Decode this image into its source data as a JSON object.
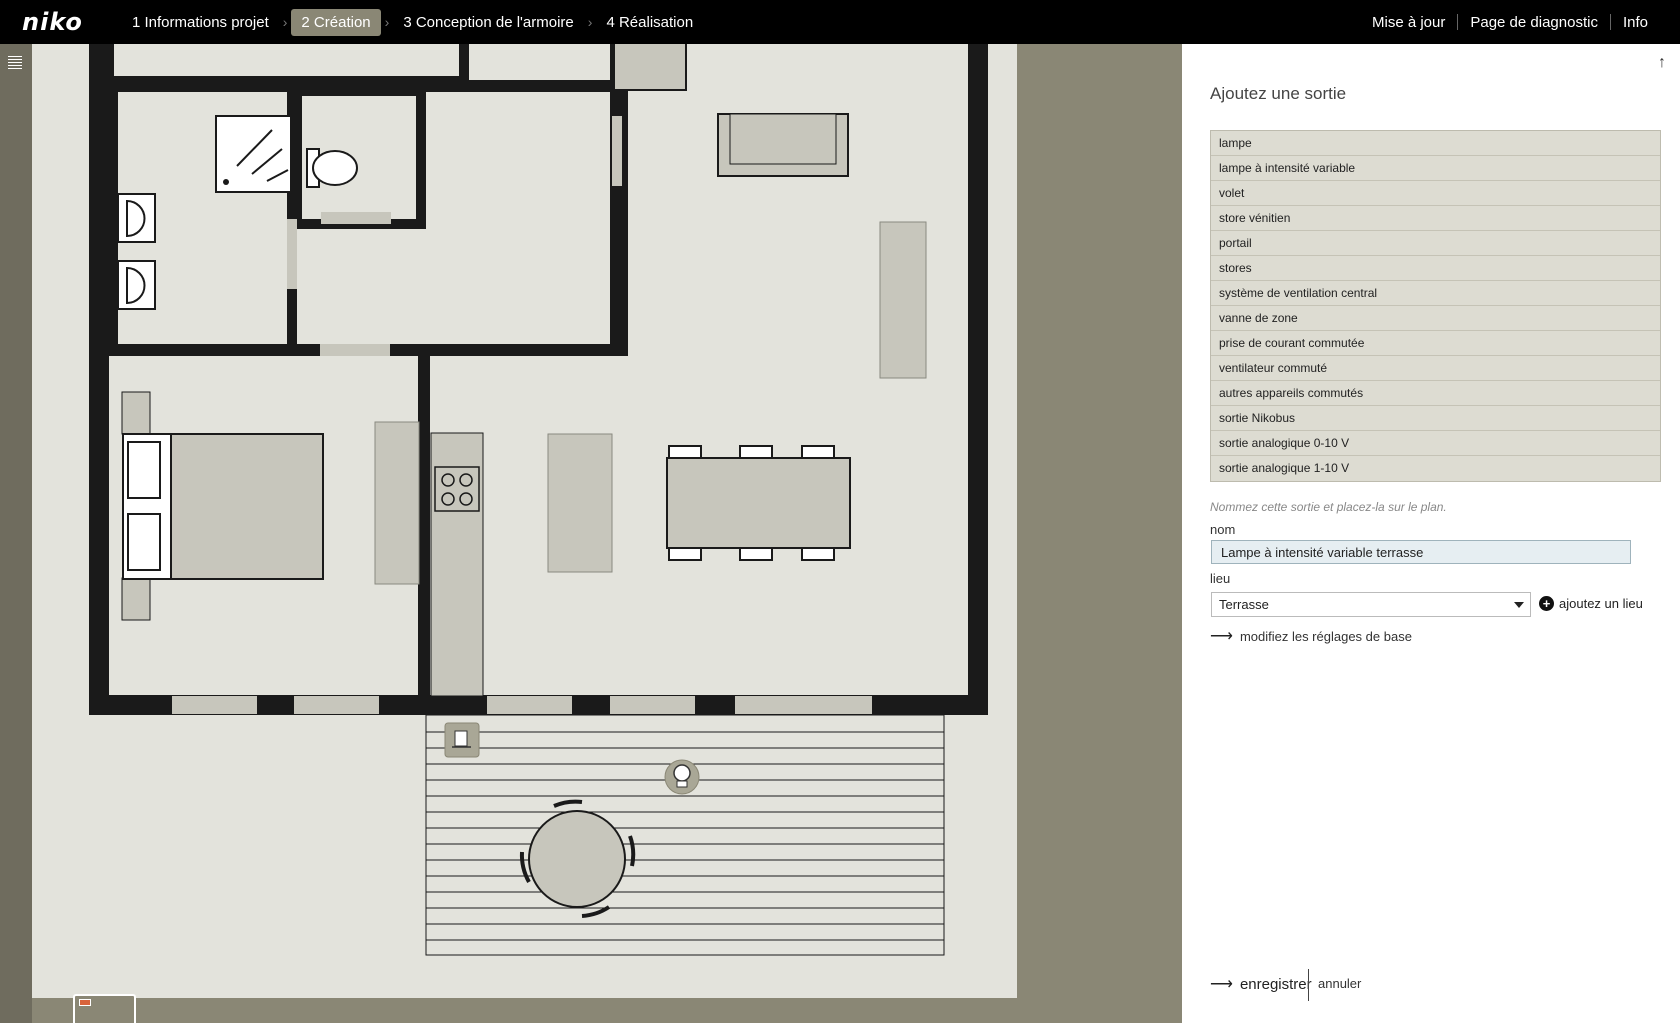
{
  "brand": {
    "logo": "niko"
  },
  "breadcrumb": [
    {
      "label": "1 Informations projet",
      "active": false
    },
    {
      "label": "2 Création",
      "active": true
    },
    {
      "label": "3 Conception de l'armoire",
      "active": false
    },
    {
      "label": "4 Réalisation",
      "active": false
    }
  ],
  "top_links": [
    "Mise à jour",
    "Page de diagnostic",
    "Info"
  ],
  "panel": {
    "title": "Ajoutez une sortie",
    "outputs": [
      "lampe",
      "lampe à intensité variable",
      "volet",
      "store vénitien",
      "portail",
      "stores",
      "système de ventilation central",
      "vanne de zone",
      "prise de courant commutée",
      "ventilateur commuté",
      "autres appareils commutés",
      "sortie Nikobus",
      "sortie analogique 0-10 V",
      "sortie analogique 1-10 V"
    ],
    "hint": "Nommez cette sortie et placez-la sur le plan.",
    "nom_label": "nom",
    "nom_value": "Lampe à intensité variable terrasse",
    "lieu_label": "lieu",
    "lieu_value": "Terrasse",
    "add_lieu": "ajoutez un lieu",
    "base_settings": "modifiez les réglages de base",
    "save": "enregistrer",
    "cancel": "annuler"
  },
  "colors": {
    "topbar": "#000000",
    "active_step": "#8a8775",
    "plan_background": "#8a8775",
    "plan_paper": "#e3e3dc",
    "wall": "#1a1a1a",
    "furniture": "#c7c6bc",
    "list_background": "#dddcd2"
  },
  "icons": [
    "menu-icon",
    "scroll-up-icon",
    "plus-icon",
    "arrow-right-icon",
    "dimmer-lamp-icon",
    "wall-switch-icon"
  ]
}
